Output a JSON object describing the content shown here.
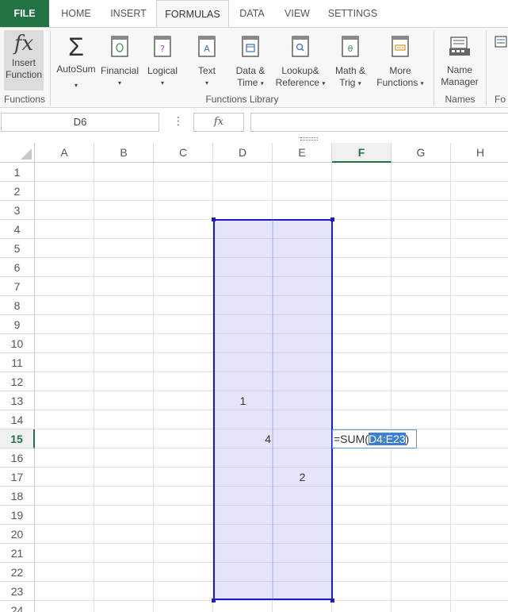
{
  "tabs": {
    "file": "FILE",
    "home": "HOME",
    "insert": "INSERT",
    "formulas": "FORMULAS",
    "data": "DATA",
    "view": "VIEW",
    "settings": "SETTINGS"
  },
  "ribbon": {
    "insert_function": {
      "line1": "Insert",
      "line2": "Function",
      "glyph": "fx"
    },
    "autosum": {
      "label": "AutoSum",
      "glyph": "Σ"
    },
    "financial": "Financial",
    "logical": "Logical",
    "text": "Text",
    "datetime": {
      "line1": "Data &",
      "line2": "Time"
    },
    "lookup": {
      "line1": "Lookup&",
      "line2": "Reference"
    },
    "math": {
      "line1": "Math &",
      "line2": "Trig"
    },
    "more": {
      "line1": "More",
      "line2": "Functions"
    },
    "name_manager": {
      "line1": "Name",
      "line2": "Manager"
    },
    "groups": {
      "functions": "Functions",
      "library": "Functions Library",
      "names": "Names",
      "partial": "Fo"
    }
  },
  "formula_bar": {
    "name_box": "D6",
    "fx": "fx",
    "value": ""
  },
  "sheet": {
    "columns": [
      "A",
      "B",
      "C",
      "D",
      "E",
      "F",
      "G",
      "H"
    ],
    "active_column": "F",
    "rows": [
      "1",
      "2",
      "3",
      "4",
      "5",
      "6",
      "7",
      "8",
      "9",
      "10",
      "11",
      "12",
      "13",
      "14",
      "15",
      "16",
      "17",
      "18",
      "19",
      "20",
      "21",
      "22",
      "23",
      "24"
    ],
    "active_row": "15",
    "cells": {
      "D13": "1",
      "D15": "4",
      "E17": "2"
    },
    "editor": {
      "prefix": "=SUM(",
      "range": "D4:E23",
      "suffix": ")"
    }
  }
}
